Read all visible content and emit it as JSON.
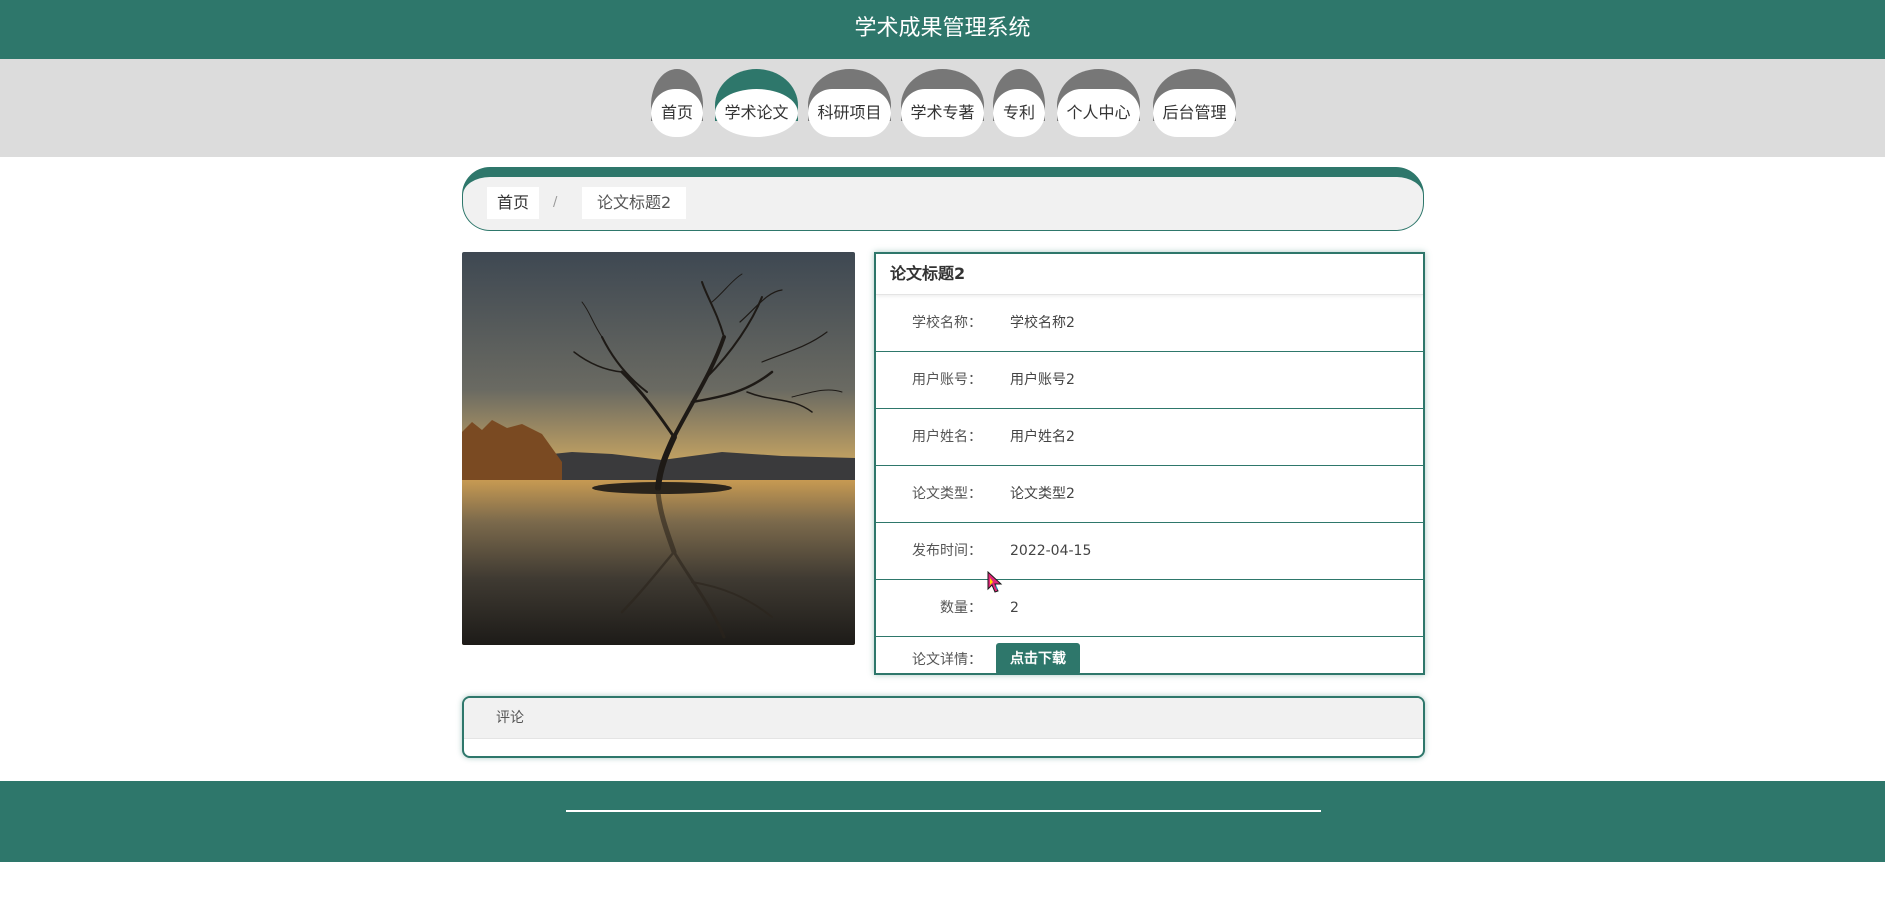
{
  "header": {
    "title": "学术成果管理系统"
  },
  "nav": {
    "items": [
      {
        "label": "首页",
        "active": false
      },
      {
        "label": "学术论文",
        "active": true
      },
      {
        "label": "科研项目",
        "active": false
      },
      {
        "label": "学术专著",
        "active": false
      },
      {
        "label": "专利",
        "active": false
      },
      {
        "label": "个人中心",
        "active": false
      },
      {
        "label": "后台管理",
        "active": false
      }
    ]
  },
  "breadcrumb": {
    "home": "首页",
    "separator": "/",
    "current": "论文标题2"
  },
  "detail": {
    "title": "论文标题2",
    "fields": [
      {
        "label": "学校名称：",
        "value": "学校名称2"
      },
      {
        "label": "用户账号：",
        "value": "用户账号2"
      },
      {
        "label": "用户姓名：",
        "value": "用户姓名2"
      },
      {
        "label": "论文类型：",
        "value": "论文类型2"
      },
      {
        "label": "发布时间：",
        "value": "2022-04-15"
      },
      {
        "label": "数量：",
        "value": "2"
      }
    ],
    "download_label": "论文详情：",
    "download_button": "点击下载"
  },
  "comment": {
    "title": "评论"
  },
  "colors": {
    "accent": "#2e776b",
    "nav_inactive": "#777777",
    "band": "#dcdcdc"
  }
}
